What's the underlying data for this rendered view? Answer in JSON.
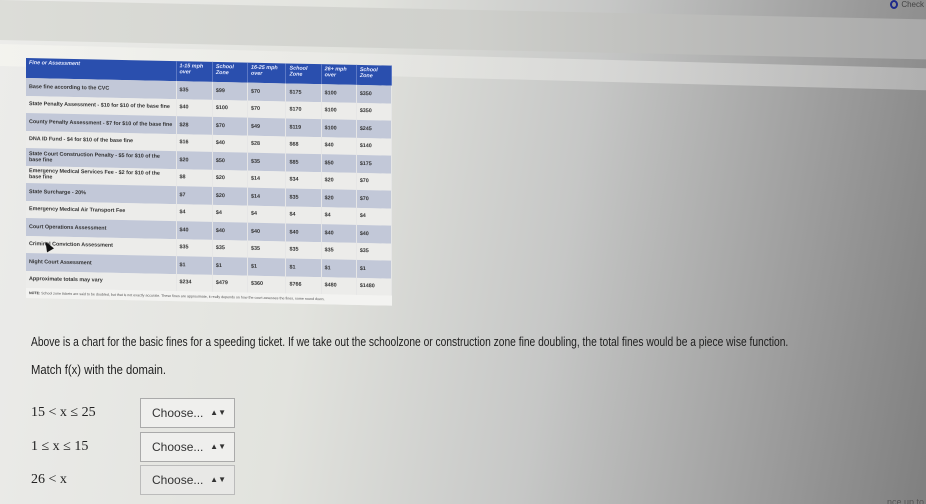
{
  "top": {
    "check_label": "Check"
  },
  "table": {
    "headers": [
      "Fine or Assessment",
      "1-15 mph over",
      "School Zone",
      "16-25 mph over",
      "School Zone",
      "26+ mph over",
      "School Zone"
    ],
    "rows": [
      {
        "label": "Base fine according to the CVC",
        "values": [
          "$35",
          "$99",
          "$70",
          "$175",
          "$100",
          "$350"
        ]
      },
      {
        "label": "State Penalty Assessment - $10 for $10 of the base fine",
        "values": [
          "$40",
          "$100",
          "$70",
          "$170",
          "$100",
          "$350"
        ]
      },
      {
        "label": "County Penalty Assessment - $7 for $10 of the base fine",
        "values": [
          "$28",
          "$70",
          "$49",
          "$119",
          "$100",
          "$245"
        ]
      },
      {
        "label": "DNA ID Fund - $4 for $10 of the base fine",
        "values": [
          "$16",
          "$40",
          "$28",
          "$68",
          "$40",
          "$140"
        ]
      },
      {
        "label": "State Court Construction Penalty - $5 for $10 of the base fine",
        "values": [
          "$20",
          "$50",
          "$35",
          "$85",
          "$50",
          "$175"
        ]
      },
      {
        "label": "Emergency Medical Services Fee - $2 for $10 of the base fine",
        "values": [
          "$8",
          "$20",
          "$14",
          "$34",
          "$20",
          "$70"
        ]
      },
      {
        "label": "State Surcharge - 20%",
        "values": [
          "$7",
          "$20",
          "$14",
          "$35",
          "$20",
          "$70"
        ]
      },
      {
        "label": "Emergency Medical Air Transport Fee",
        "values": [
          "$4",
          "$4",
          "$4",
          "$4",
          "$4",
          "$4"
        ]
      },
      {
        "label": "Court Operations Assessment",
        "values": [
          "$40",
          "$40",
          "$40",
          "$40",
          "$40",
          "$40"
        ]
      },
      {
        "label": "Criminal Conviction Assessment",
        "values": [
          "$35",
          "$35",
          "$35",
          "$35",
          "$35",
          "$35"
        ]
      },
      {
        "label": "Night Court Assessment",
        "values": [
          "$1",
          "$1",
          "$1",
          "$1",
          "$1",
          "$1"
        ]
      },
      {
        "label": "Approximate totals may vary",
        "values": [
          "$234",
          "$479",
          "$360",
          "$766",
          "$480",
          "$1480"
        ]
      }
    ],
    "note_bold": "NOTE:",
    "note": "School zone tickets are said to be doubled, but that is not exactly accurate. These fines are approximate, it really depends on how the court assesses the fines, some round down."
  },
  "question": {
    "prompt": "Above is a chart for the basic fines for a speeding ticket. If we take out the schoolzone or construction zone fine doubling, the total fines would be a piece wise function.",
    "instruction": "Match f(x) with the domain.",
    "items": [
      {
        "domain": "15 < x ≤ 25",
        "selected": "Choose..."
      },
      {
        "domain": "1 ≤ x ≤ 15",
        "selected": "Choose..."
      },
      {
        "domain": "26 < x",
        "selected": "Choose..."
      }
    ]
  },
  "footer": {
    "link_partial": "...nce up to"
  }
}
